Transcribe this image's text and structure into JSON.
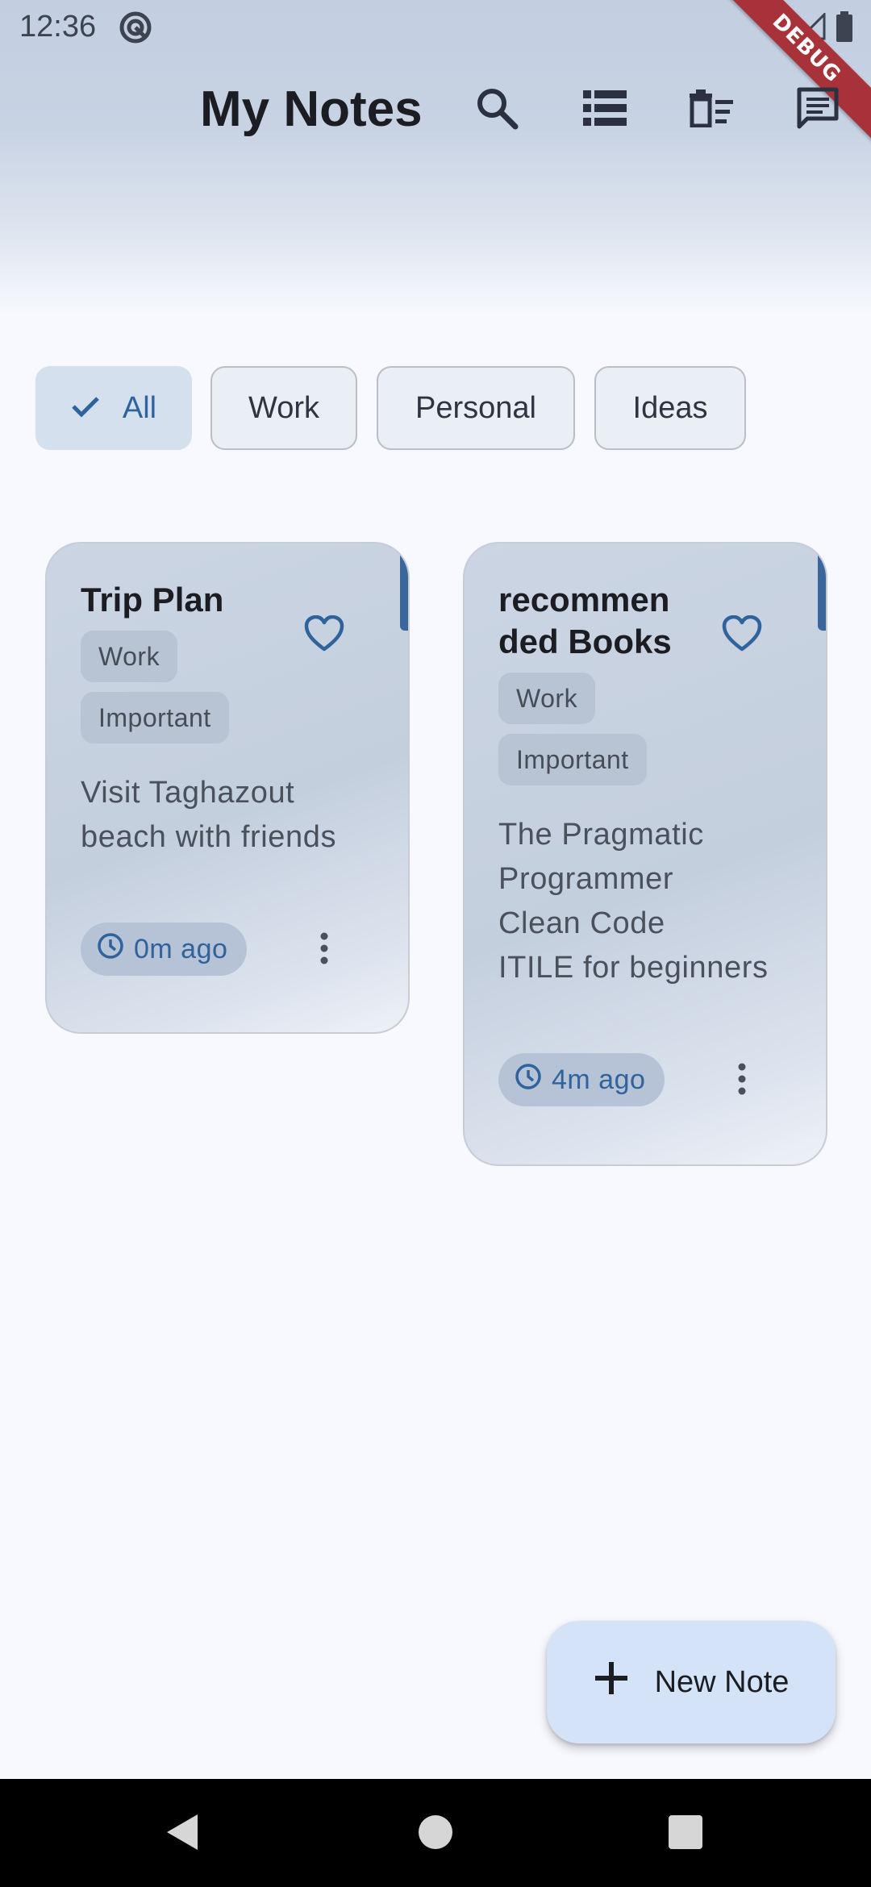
{
  "status_bar": {
    "time": "12:36",
    "icons": [
      "app-notification-icon",
      "wifi-icon",
      "signal-icon",
      "battery-icon"
    ]
  },
  "debug_banner": "DEBUG",
  "header": {
    "title": "My Notes",
    "actions": [
      "search-icon",
      "view-list-icon",
      "delete-sweep-icon",
      "chat-icon"
    ]
  },
  "filters": {
    "chips": [
      {
        "label": "All",
        "selected": true
      },
      {
        "label": "Work",
        "selected": false
      },
      {
        "label": "Personal",
        "selected": false
      },
      {
        "label": "Ideas",
        "selected": false
      }
    ]
  },
  "notes": [
    {
      "title": "Trip Plan",
      "tags": [
        "Work",
        "Important"
      ],
      "body": "Visit Taghazout\nbeach with friends",
      "time": "0m ago",
      "favorite": false
    },
    {
      "title": "recommen\nded Books",
      "tags": [
        "Work",
        "Important"
      ],
      "body": "The Pragmatic\nProgrammer\nClean Code\nITILE for beginners",
      "time": "4m ago",
      "favorite": false
    }
  ],
  "fab": {
    "label": "New Note",
    "icon": "plus-icon"
  },
  "colors": {
    "accent": "#30629c",
    "card_accent_bar": "#3b669b",
    "background": "#f7f9fe",
    "fab_bg": "#d5e3f8"
  }
}
